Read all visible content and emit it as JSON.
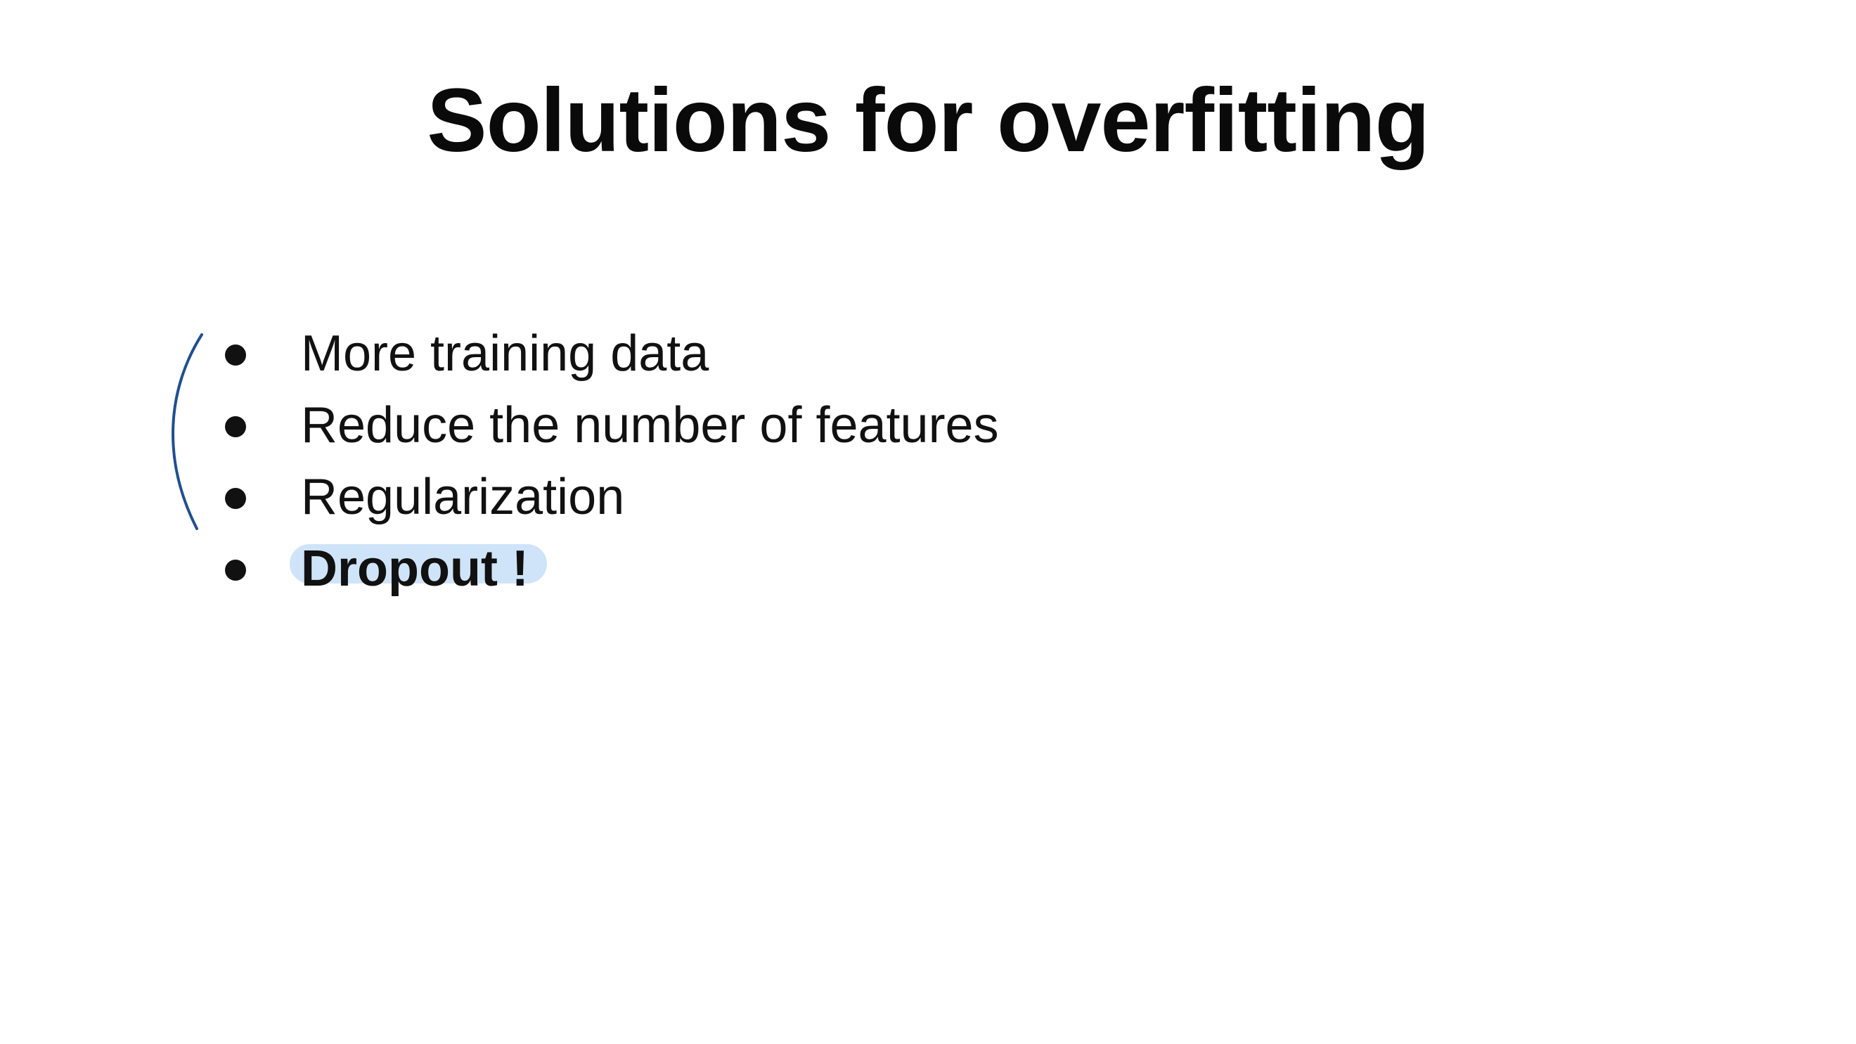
{
  "slide": {
    "title": "Solutions for overfitting",
    "bullets": [
      {
        "text": "More training data",
        "emphasis": false
      },
      {
        "text": "Reduce the number of features",
        "emphasis": false
      },
      {
        "text": "Regularization",
        "emphasis": false
      },
      {
        "text": "Dropout !",
        "emphasis": true
      }
    ],
    "highlight_color": "#cfe4f8",
    "annotation_color": "#1f4f92"
  }
}
